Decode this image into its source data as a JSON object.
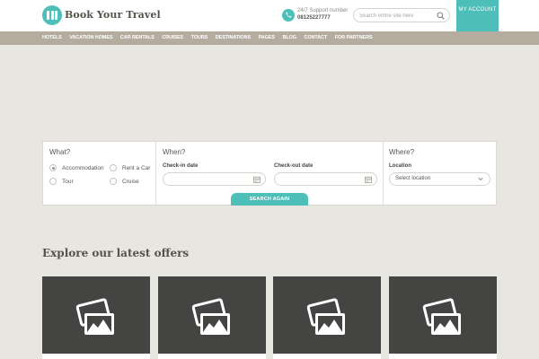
{
  "header": {
    "logo_text": "Book Your Travel",
    "support_label": "24/7 Support number",
    "support_number": "08125227777",
    "search_placeholder": "Search entire site here",
    "account_label": "MY ACCOUNT"
  },
  "nav": {
    "items": [
      "Hotels",
      "Vacation homes",
      "Car rentals",
      "Cruises",
      "Tours",
      "Destinations",
      "Pages",
      "Blog",
      "Contact",
      "For partners"
    ]
  },
  "search_panel": {
    "what_title": "What?",
    "options": [
      {
        "label": "Accommodation",
        "checked": true
      },
      {
        "label": "Rent a Car",
        "checked": false
      },
      {
        "label": "Tour",
        "checked": false
      },
      {
        "label": "Cruise",
        "checked": false
      }
    ],
    "when_title": "When?",
    "checkin_label": "Check-in date",
    "checkout_label": "Check-out date",
    "where_title": "Where?",
    "location_label": "Location",
    "location_value": "Select location",
    "button_label": "SEARCH AGAIN"
  },
  "offers": {
    "title": "Explore our latest offers",
    "card_count": 4
  },
  "colors": {
    "accent": "#4dbfb8",
    "nav_bg": "#b5aca0",
    "page_bg": "#e8e6e1",
    "card_bg": "#444442"
  }
}
